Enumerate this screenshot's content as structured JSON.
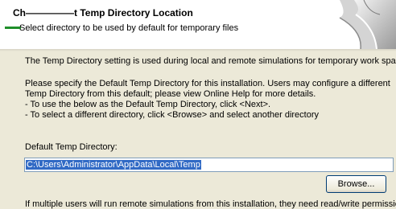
{
  "header": {
    "title": "Ch—————t Temp Directory Location",
    "subtitle": "Select directory to be used by default for temporary files"
  },
  "content": {
    "intro": "The Temp Directory setting is used during local and remote simulations for temporary work space.",
    "instructions": [
      "Please specify the Default Temp Directory for this installation. Users may configure a different Temp Directory from this default; please view Online Help for more details.",
      "- To use the below as the Default Temp Directory, click  <Next>.",
      "- To select a different directory, click <Browse> and select another directory"
    ]
  },
  "temp_dir": {
    "label": "Default Temp Directory:",
    "value": "C:\\Users\\Administrator\\AppData\\Local\\Temp"
  },
  "buttons": {
    "browse": "Browse..."
  },
  "footer": {
    "partial_text": "If multiple users will run remote simulations from this installation, they need read/write permissions"
  },
  "icons": {
    "wizard": "page-curl-icon"
  },
  "colors": {
    "dialog_bg": "#ece9d8",
    "header_bg": "#ffffff",
    "selection": "#316ac5",
    "button_border": "#003c74"
  }
}
